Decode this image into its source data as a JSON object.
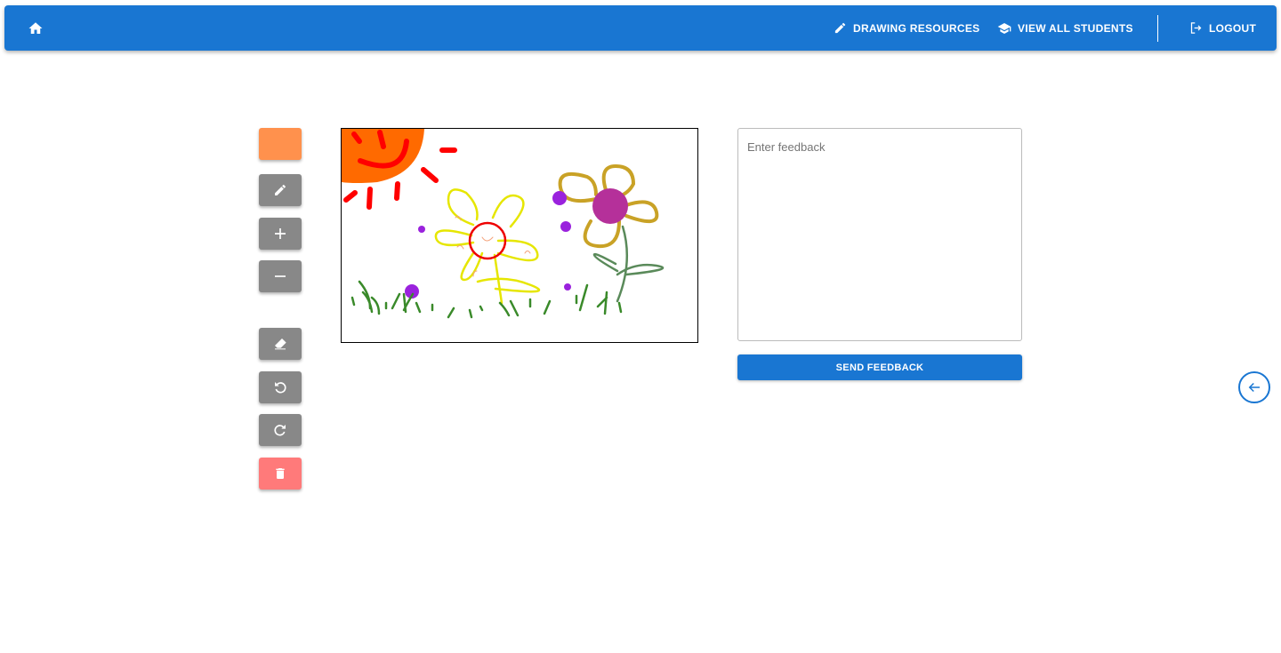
{
  "nav": {
    "home_icon": "home-icon",
    "drawing_resources": "DRAWING RESOURCES",
    "view_all_students": "VIEW ALL STUDENTS",
    "logout": "LOGOUT"
  },
  "toolbar": {
    "current_color": "#ff914d",
    "tools": [
      "pencil-icon",
      "plus-icon",
      "minus-icon",
      "eraser-icon",
      "undo-icon",
      "redo-icon",
      "trash-icon"
    ]
  },
  "feedback": {
    "placeholder": "Enter feedback",
    "send_label": "SEND FEEDBACK"
  },
  "colors": {
    "primary": "#1976d2",
    "tool": "#888888",
    "delete": "#ff7a7a"
  }
}
